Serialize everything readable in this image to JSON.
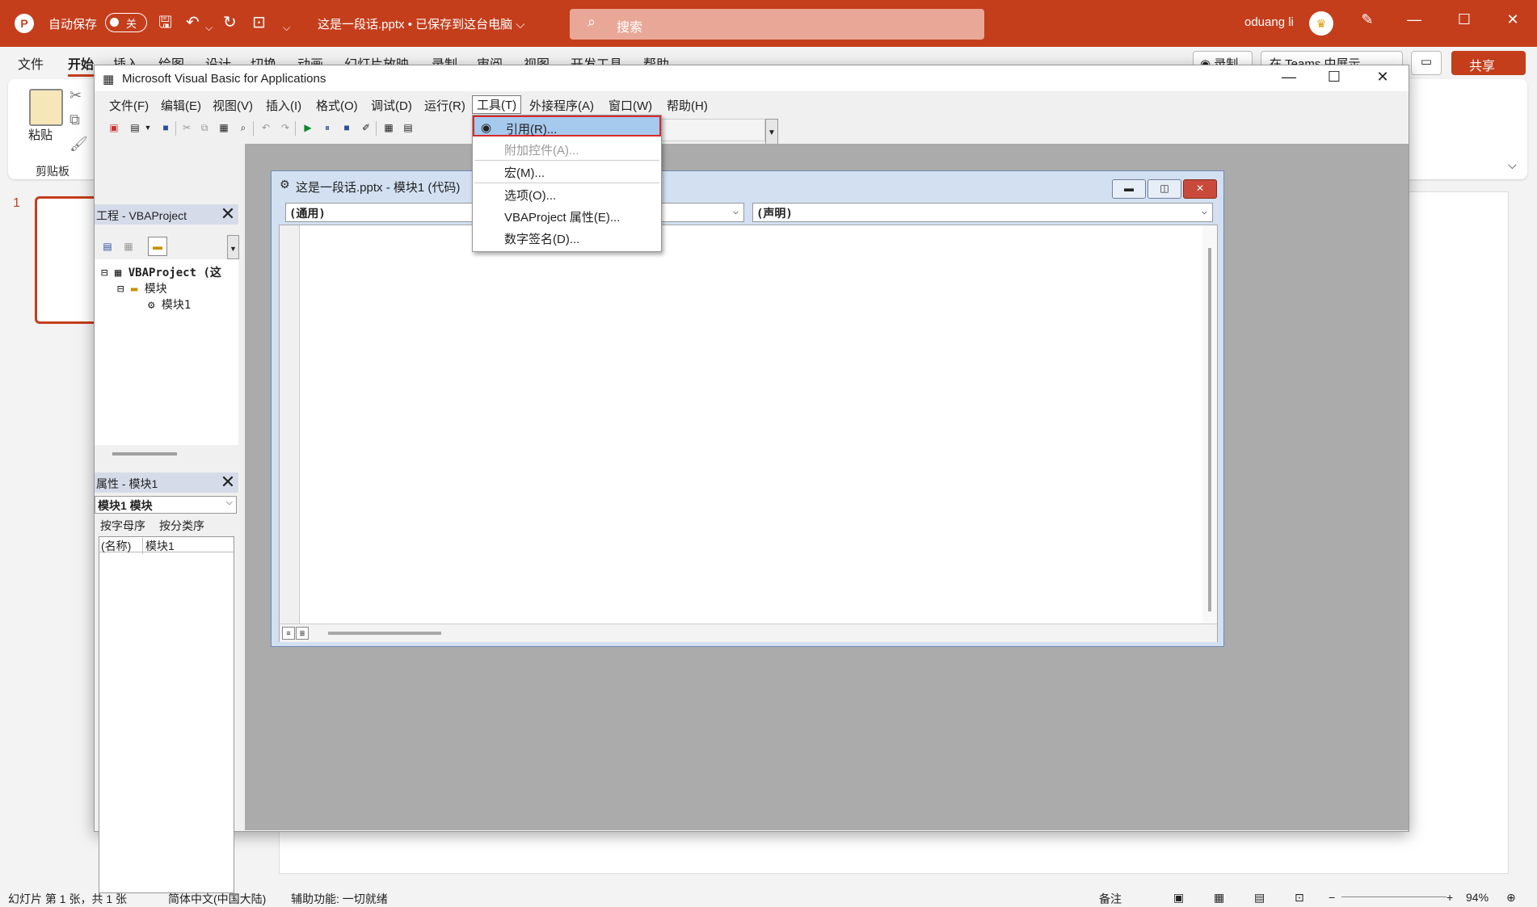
{
  "ppt": {
    "autosave_label": "自动保存",
    "autosave_state": "关",
    "doc_title": "这是一段话.pptx • 已保存到这台电脑 ⌵",
    "search_placeholder": "搜索",
    "user_name": "oduang li",
    "tabs": [
      "文件",
      "开始",
      "插入",
      "绘图",
      "设计",
      "切换",
      "动画",
      "幻灯片放映",
      "录制",
      "审阅",
      "视图",
      "开发工具",
      "帮助"
    ],
    "record_btn": "◉ 录制",
    "teams_btn": "在 Teams 中展示",
    "share_btn": "共享",
    "ribbon": {
      "paste_label": "粘贴",
      "group_label": "剪贴板"
    },
    "slide_number": "1",
    "status": {
      "slide_info": "幻灯片 第 1 张，共 1 张",
      "language": "简体中文(中国大陆)",
      "accessibility": "辅助功能: 一切就绪",
      "notes": "备注",
      "zoom": "94%"
    }
  },
  "vba": {
    "title": "Microsoft Visual Basic for Applications",
    "menu": [
      "文件(F)",
      "编辑(E)",
      "视图(V)",
      "插入(I)",
      "格式(O)",
      "调试(D)",
      "运行(R)",
      "工具(T)",
      "外接程序(A)",
      "窗口(W)",
      "帮助(H)"
    ],
    "project_pane": {
      "title": "工程 - VBAProject",
      "tree": {
        "root": "VBAProject (这",
        "folder": "模块",
        "module": "模块1"
      }
    },
    "properties_pane": {
      "title": "属性 - 模块1",
      "object_combo": "模块1 模块",
      "tab_alpha": "按字母序",
      "tab_category": "按分类序",
      "name_key": "(名称)",
      "name_value": "模块1"
    },
    "code_window": {
      "title": "这是一段话.pptx - 模块1 (代码)",
      "object_combo": "(通用)",
      "proc_combo": "(声明)"
    },
    "tools_menu": {
      "items": [
        {
          "label": "引用(R)...",
          "enabled": true,
          "highlighted": true
        },
        {
          "label": "附加控件(A)...",
          "enabled": false
        },
        {
          "label": "宏(M)...",
          "enabled": true
        },
        {
          "label": "选项(O)...",
          "enabled": true
        },
        {
          "label": "VBAProject 属性(E)...",
          "enabled": true
        },
        {
          "label": "数字签名(D)...",
          "enabled": true
        }
      ]
    }
  },
  "colors": {
    "ppt_accent": "#c43e1c",
    "menu_highlight": "#a6c9ee",
    "highlight_border": "#d72b2b"
  }
}
